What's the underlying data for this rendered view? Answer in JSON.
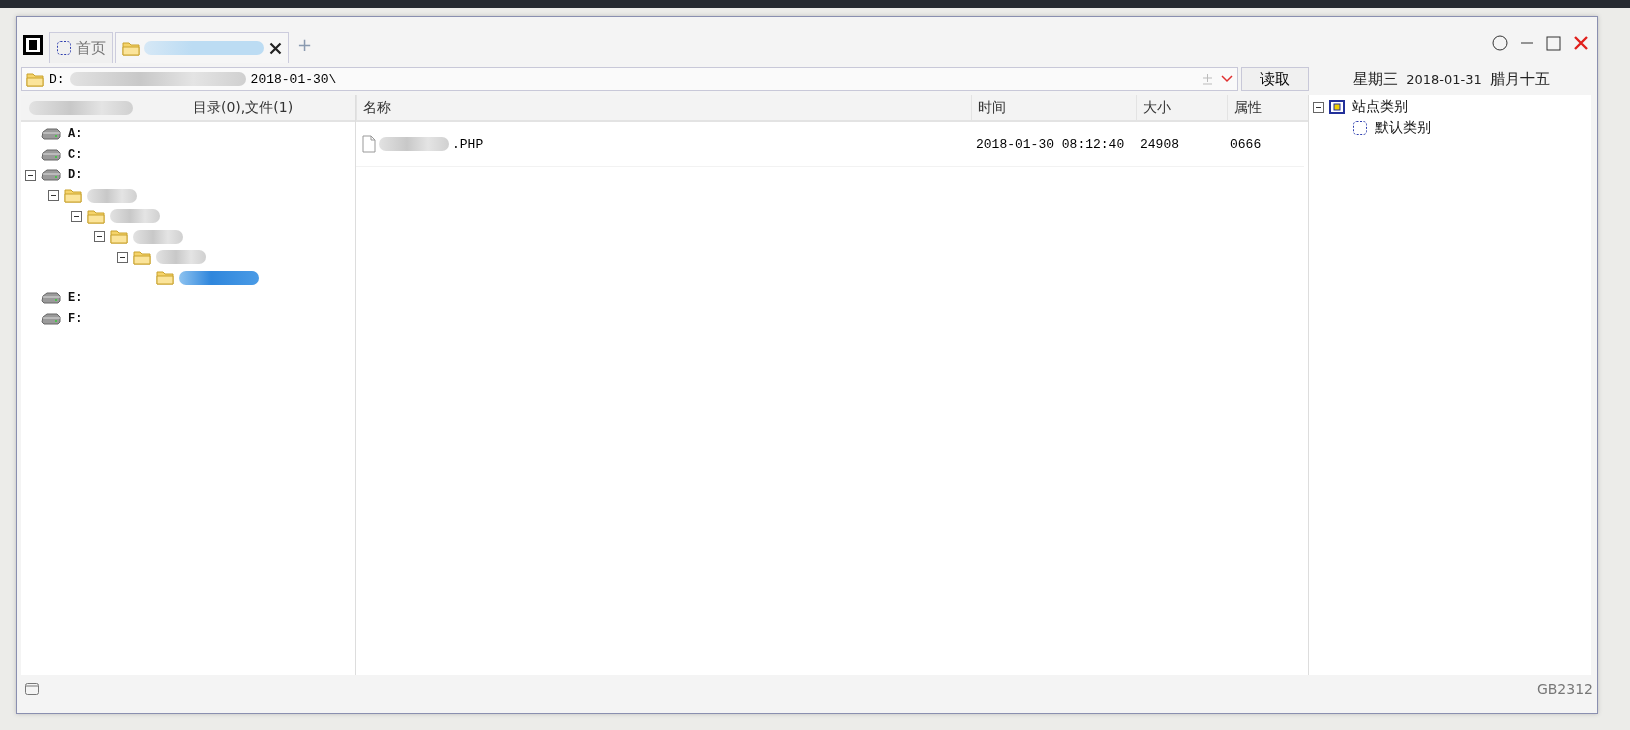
{
  "tabs": [
    {
      "kind": "home",
      "label": "首页",
      "selected": false
    },
    {
      "kind": "folder",
      "selected": true,
      "closable": true
    }
  ],
  "new_tab": "+",
  "address": {
    "start": "D:",
    "end": "2018-01-30\\",
    "button": "读取"
  },
  "left_header": {
    "summary": "目录(0),文件(1)"
  },
  "tree": [
    {
      "kind": "drive",
      "label": "A:",
      "selected": false
    },
    {
      "kind": "drive",
      "label": "C:",
      "selected": false
    },
    {
      "kind": "drive",
      "label": "D:",
      "selected": false,
      "expanded": true,
      "children": [
        {
          "kind": "folder",
          "selected": false,
          "expanded": true,
          "children": [
            {
              "kind": "folder",
              "selected": false,
              "expanded": true,
              "children": [
                {
                  "kind": "folder",
                  "selected": false,
                  "expanded": true,
                  "children": [
                    {
                      "kind": "folder",
                      "selected": false,
                      "expanded": true,
                      "children": [
                        {
                          "kind": "folder",
                          "selected": true
                        }
                      ]
                    }
                  ]
                }
              ]
            }
          ]
        }
      ]
    },
    {
      "kind": "drive",
      "label": "E:",
      "selected": false
    },
    {
      "kind": "drive",
      "label": "F:",
      "selected": false
    }
  ],
  "columns": [
    "名称",
    "时间",
    "大小",
    "属性"
  ],
  "files": [
    {
      "name": ".PHP",
      "time": "2018-01-30 08:12:40",
      "size": "24908",
      "attr": "0666",
      "selected": false
    }
  ],
  "calendar": {
    "weekday": "星期三",
    "date": "2018-01-31",
    "lunar": "腊月十五"
  },
  "sites": [
    {
      "kind": "category",
      "label": "站点类别",
      "expanded": true,
      "children": [
        {
          "kind": "site",
          "label": "默认类别"
        }
      ]
    }
  ],
  "status_bar": {
    "encoding": "GB2312"
  }
}
